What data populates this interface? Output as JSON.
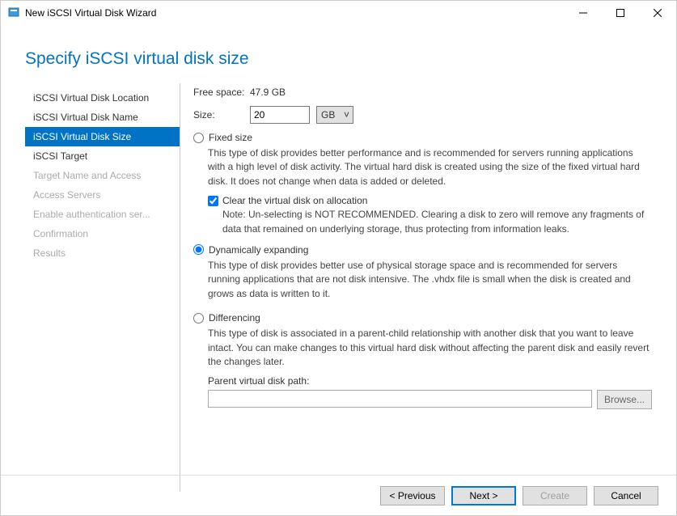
{
  "window": {
    "title": "New iSCSI Virtual Disk Wizard"
  },
  "header": "Specify iSCSI virtual disk size",
  "sidebar": {
    "items": [
      {
        "label": "iSCSI Virtual Disk Location",
        "state": "normal"
      },
      {
        "label": "iSCSI Virtual Disk Name",
        "state": "normal"
      },
      {
        "label": "iSCSI Virtual Disk Size",
        "state": "selected"
      },
      {
        "label": "iSCSI Target",
        "state": "normal"
      },
      {
        "label": "Target Name and Access",
        "state": "disabled"
      },
      {
        "label": "Access Servers",
        "state": "disabled"
      },
      {
        "label": "Enable authentication ser...",
        "state": "disabled"
      },
      {
        "label": "Confirmation",
        "state": "disabled"
      },
      {
        "label": "Results",
        "state": "disabled"
      }
    ]
  },
  "content": {
    "free_space_label": "Free space:",
    "free_space_value": "47.9 GB",
    "size_label": "Size:",
    "size_value": "20",
    "size_unit": "GB",
    "fixed": {
      "label": "Fixed size",
      "desc": "This type of disk provides better performance and is recommended for servers running applications with a high level of disk activity. The virtual hard disk is created using the size of the fixed virtual hard disk. It does not change when data is added or deleted.",
      "clear_label": "Clear the virtual disk on allocation",
      "clear_note": "Note: Un-selecting is NOT RECOMMENDED. Clearing a disk to zero will remove any fragments of data that remained on underlying storage, thus protecting from information leaks."
    },
    "dynamic": {
      "label": "Dynamically expanding",
      "desc": "This type of disk provides better use of physical storage space and is recommended for servers running applications that are not disk intensive. The .vhdx file is small when the disk is created and grows as data is written to it."
    },
    "diff": {
      "label": "Differencing",
      "desc": "This type of disk is associated in a parent-child relationship with another disk that you want to leave intact. You can make changes to this virtual hard disk without affecting the parent disk and easily revert the changes later.",
      "path_label": "Parent virtual disk path:",
      "browse": "Browse..."
    }
  },
  "footer": {
    "previous": "< Previous",
    "next": "Next >",
    "create": "Create",
    "cancel": "Cancel"
  }
}
